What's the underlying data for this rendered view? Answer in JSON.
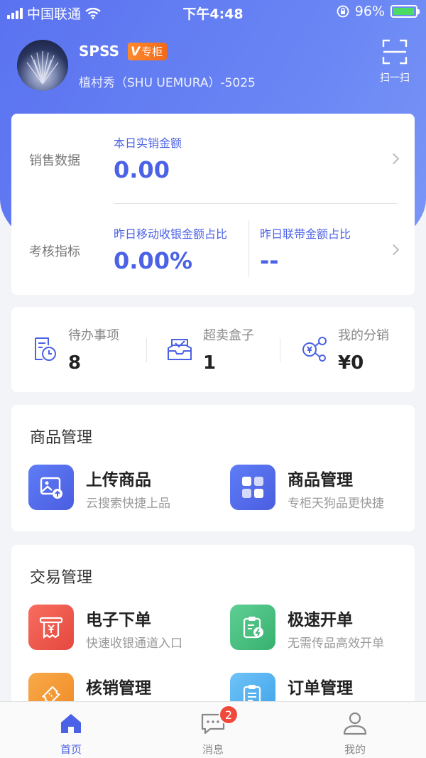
{
  "status_bar": {
    "carrier": "中国联通",
    "time": "下午4:48",
    "battery": "96%",
    "battery_level": 0.96
  },
  "profile": {
    "store_name": "SPSS",
    "badge_label": "专柜",
    "badge_mark": "V",
    "subtitle": "植村秀（SHU UEMURA）-5025",
    "scan_label": "扫一扫"
  },
  "sales": {
    "row1_label": "销售数据",
    "today_title": "本日实销金额",
    "today_value": "0.00",
    "row2_label": "考核指标",
    "mobile_title": "昨日移动收银金额占比",
    "mobile_value": "0.00%",
    "joint_title": "昨日联带金额占比",
    "joint_value": "--"
  },
  "stats": {
    "todo_label": "待办事项",
    "todo_value": "8",
    "box_label": "超卖盒子",
    "box_value": "1",
    "dist_label": "我的分销",
    "dist_value": "¥0"
  },
  "goods": {
    "title": "商品管理",
    "items": [
      {
        "title": "上传商品",
        "subtitle": "云搜索快捷上品"
      },
      {
        "title": "商品管理",
        "subtitle": "专柜天狗品更快捷"
      }
    ]
  },
  "trade": {
    "title": "交易管理",
    "items": [
      {
        "title": "电子下单",
        "subtitle": "快速收银通道入口"
      },
      {
        "title": "极速开单",
        "subtitle": "无需传品高效开单"
      },
      {
        "title": "核销管理",
        "subtitle": ""
      },
      {
        "title": "订单管理",
        "subtitle": ""
      }
    ]
  },
  "nav": {
    "home": "首页",
    "messages": "消息",
    "messages_badge": "2",
    "mine": "我的"
  },
  "colors": {
    "brand": "#4c62e6",
    "badge_orange": "#f06a1c",
    "message_badge": "#f0493c"
  }
}
